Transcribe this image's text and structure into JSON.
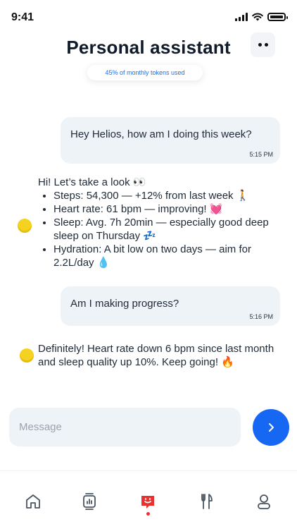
{
  "status_bar": {
    "time": "9:41"
  },
  "header": {
    "title": "Personal assistant",
    "tokens_used": "45% of monthly tokens used"
  },
  "messages": [
    {
      "role": "user",
      "text": "Hey Helios, how am I doing this week?",
      "time": "5:15 PM"
    },
    {
      "role": "assistant",
      "intro": "Hi! Let’s take a look 👀",
      "items": [
        "Steps: 54,300 — +12% from last week 🚶",
        "Heart rate: 61 bpm — improving! 💓",
        "Sleep: Avg. 7h 20min — especially good deep sleep on Thursday 💤",
        "Hydration: A bit low on two days — aim for 2.2L/day 💧"
      ]
    },
    {
      "role": "user",
      "text": "Am I making progress?",
      "time": "5:16 PM"
    },
    {
      "role": "assistant",
      "text": "Definitely! Heart rate down 6 bpm since last month and sleep quality up 10%. Keep going! 🔥"
    }
  ],
  "composer": {
    "placeholder": "Message"
  },
  "nav": {
    "items": [
      "home-icon",
      "activity-icon",
      "assistant-icon",
      "nutrition-icon",
      "profile-icon"
    ],
    "active_index": 2
  },
  "colors": {
    "accent": "#1668f2",
    "bubble": "#eef3f8",
    "active_nav": "#e8322f",
    "avatar": "#f4d21f"
  }
}
